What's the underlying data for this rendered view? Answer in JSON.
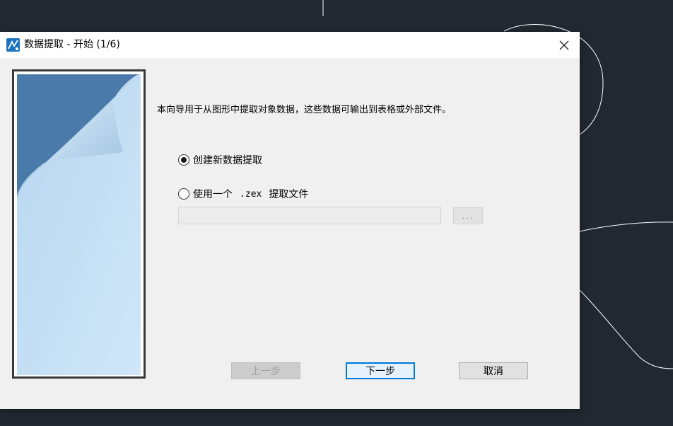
{
  "window": {
    "title": "数据提取 - 开始 (1/6)"
  },
  "icons": {
    "app": "data-extraction-app-icon",
    "close": "close-icon"
  },
  "content": {
    "intro": "本向导用于从图形中提取对象数据，这些数据可输出到表格或外部文件。",
    "options": [
      {
        "label": "创建新数据提取",
        "checked": true
      },
      {
        "label_prefix": "使用一个",
        "label_ext": ".zex",
        "label_suffix": "提取文件",
        "checked": false
      }
    ],
    "file_path_value": "",
    "browse_label": "..."
  },
  "buttons": {
    "back": "上一步",
    "next": "下一步",
    "cancel": "取消"
  },
  "colors": {
    "background": "#222831",
    "dialog": "#f0f0f0",
    "default_button_border": "#0078d7"
  }
}
